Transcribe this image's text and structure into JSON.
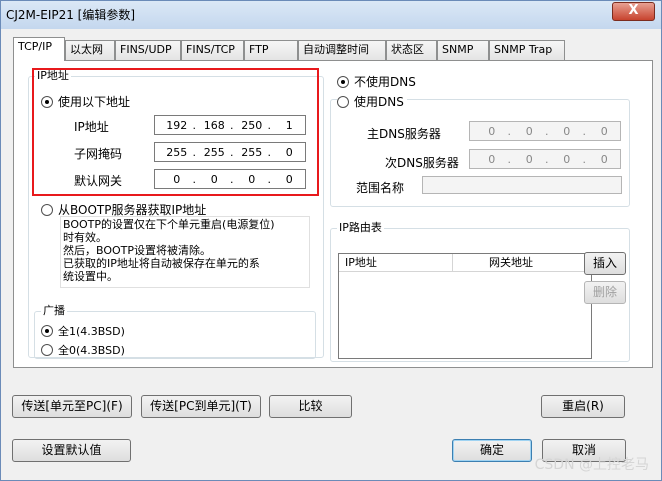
{
  "window": {
    "title": "CJ2M-EIP21 [编辑参数]",
    "close_label": "X"
  },
  "tabs": [
    {
      "label": "TCP/IP"
    },
    {
      "label": "以太网"
    },
    {
      "label": "FINS/UDP"
    },
    {
      "label": "FINS/TCP"
    },
    {
      "label": "FTP"
    },
    {
      "label": "自动调整时间"
    },
    {
      "label": "状态区"
    },
    {
      "label": "SNMP"
    },
    {
      "label": "SNMP Trap"
    }
  ],
  "ip_group": {
    "legend": "IP地址",
    "use_following_label": "使用以下地址",
    "use_following_selected": true,
    "ip_label": "IP地址",
    "ip_octets": [
      "192",
      "168",
      "250",
      "1"
    ],
    "mask_label": "子网掩码",
    "mask_octets": [
      "255",
      "255",
      "255",
      "0"
    ],
    "gateway_label": "默认网关",
    "gateway_octets": [
      "0",
      "0",
      "0",
      "0"
    ],
    "bootp_label": "从BOOTP服务器获取IP地址",
    "bootp_selected": false,
    "bootp_note": "BOOTP的设置仅在下个单元重启(电源复位)\n时有效。\n然后，BOOTP设置将被清除。\n已获取的IP地址将自动被保存在单元的系\n统设置中。"
  },
  "dns": {
    "no_dns_label": "不使用DNS",
    "no_dns_selected": true,
    "use_dns_label": "使用DNS",
    "use_dns_selected": false,
    "primary_label": "主DNS服务器",
    "primary_octets": [
      "0",
      "0",
      "0",
      "0"
    ],
    "secondary_label": "次DNS服务器",
    "secondary_octets": [
      "0",
      "0",
      "0",
      "0"
    ],
    "domain_label": "范围名称",
    "domain_value": ""
  },
  "broadcast": {
    "legend": "广播",
    "all1_label": "全1(4.3BSD)",
    "all1_selected": true,
    "all0_label": "全0(4.3BSD)",
    "all0_selected": false
  },
  "routing": {
    "legend": "IP路由表",
    "columns": [
      "IP地址",
      "网关地址"
    ],
    "insert_label": "插入",
    "delete_label": "删除"
  },
  "buttons": {
    "transfer_to_pc": "传送[单元至PC](F)",
    "transfer_to_unit": "传送[PC到单元](T)",
    "compare": "比较",
    "restart": "重启(R)",
    "set_defaults": "设置默认值",
    "ok": "确定",
    "cancel": "取消"
  },
  "watermark": "CSDN @上控老马"
}
